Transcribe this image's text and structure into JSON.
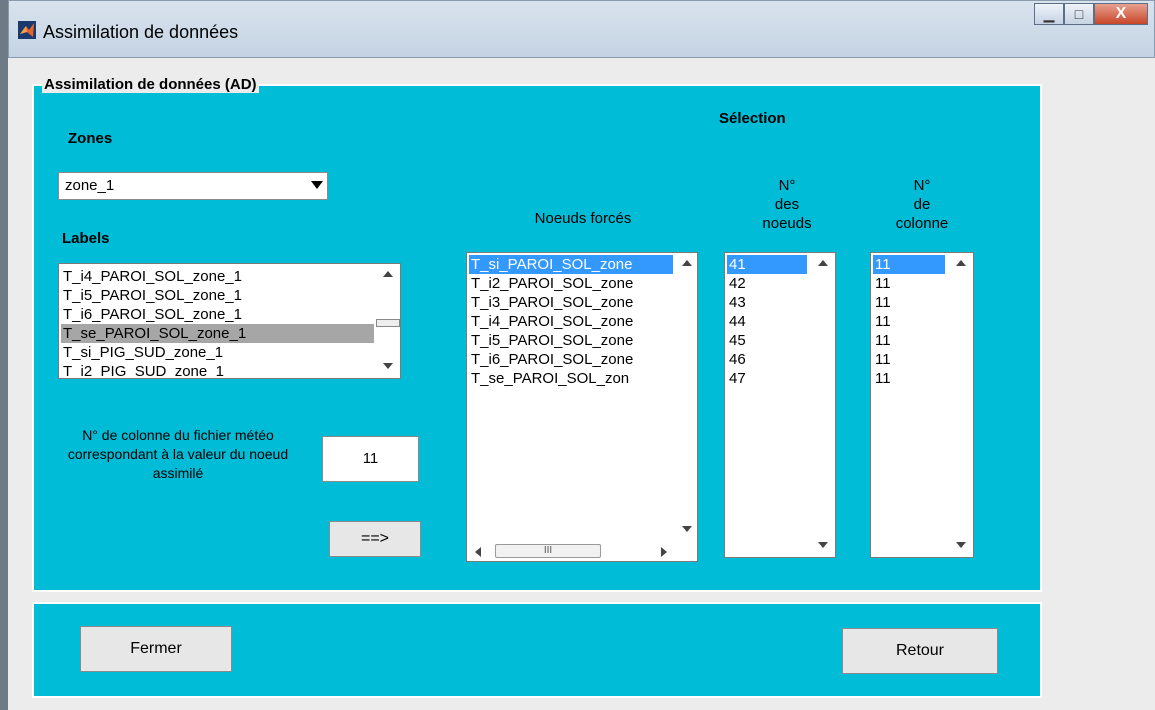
{
  "window": {
    "title": "Assimilation de données",
    "minimize_symbol": "▁",
    "maximize_symbol": "□",
    "close_symbol": "X"
  },
  "panel": {
    "title": "Assimilation de données (AD)"
  },
  "zones": {
    "label": "Zones",
    "selected": "zone_1"
  },
  "labels": {
    "label": "Labels",
    "items": [
      "T_i4_PAROI_SOL_zone_1",
      "T_i5_PAROI_SOL_zone_1",
      "T_i6_PAROI_SOL_zone_1",
      "T_se_PAROI_SOL_zone_1",
      "T_si_PIG_SUD_zone_1",
      "T_i2_PIG_SUD_zone_1"
    ],
    "selected_index": 3
  },
  "column_prompt": "N° de colonne du fichier météo correspondant à la valeur du noeud assimilé",
  "column_value": "11",
  "add_button": "==>",
  "selection": {
    "heading": "Sélection",
    "forced_nodes": {
      "label": "Noeuds forcés",
      "items": [
        "T_si_PAROI_SOL_zone",
        "T_i2_PAROI_SOL_zone",
        "T_i3_PAROI_SOL_zone",
        "T_i4_PAROI_SOL_zone",
        "T_i5_PAROI_SOL_zone",
        "T_i6_PAROI_SOL_zone",
        "T_se_PAROI_SOL_zon"
      ],
      "hscroll_label": "III"
    },
    "node_numbers": {
      "label_line1": "N°",
      "label_line2": "des",
      "label_line3": "noeuds",
      "items": [
        "41",
        "42",
        "43",
        "44",
        "45",
        "46",
        "47"
      ]
    },
    "column_numbers": {
      "label_line1": "N°",
      "label_line2": "de",
      "label_line3": "colonne",
      "items": [
        "11",
        "11",
        "11",
        "11",
        "11",
        "11",
        "11"
      ]
    }
  },
  "footer": {
    "close_button": "Fermer",
    "back_button": "Retour"
  },
  "colors": {
    "panel": "#00bcd6",
    "selection_blue": "#3399ff",
    "selection_gray": "#a6a6a6"
  }
}
